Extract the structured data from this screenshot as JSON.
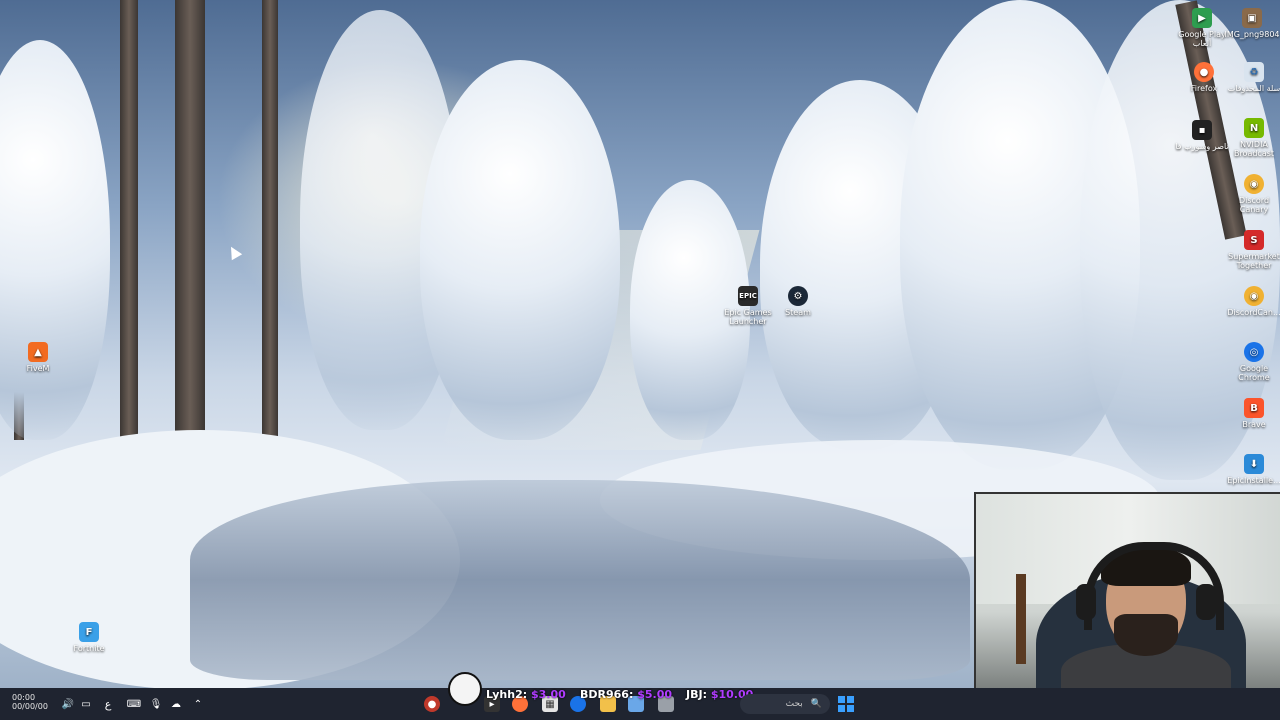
{
  "desktop_icons": {
    "right_column": [
      {
        "label": "Google Play ألعاب",
        "icon": "google-play-games-icon",
        "color": "#2e9d4f"
      },
      {
        "label": "IMG_png9804",
        "icon": "image-file-icon",
        "color": "#8a6a4a"
      },
      {
        "label": "سلة المحذوفات",
        "icon": "recycle-bin-icon",
        "color": "#d9e4ef"
      },
      {
        "label": "Firefox",
        "icon": "firefox-icon",
        "color": "#ff7139"
      },
      {
        "label": "ناصر وسورب فا",
        "icon": "shortcut-icon",
        "color": "#222222"
      },
      {
        "label": "NVIDIA Broadcast",
        "icon": "nvidia-icon",
        "color": "#76b900"
      },
      {
        "label": "Discord Canary",
        "icon": "discord-canary-icon",
        "color": "#f0b132"
      },
      {
        "label": "Supermarket Together",
        "icon": "supermarket-together-icon",
        "color": "#d42a2a"
      },
      {
        "label": "DiscordCan...",
        "icon": "discord-canary-icon",
        "color": "#f0b132"
      },
      {
        "label": "Google Chrome",
        "icon": "chrome-icon",
        "color": "#1a73e8"
      },
      {
        "label": "Brave",
        "icon": "brave-icon",
        "color": "#fb542b"
      },
      {
        "label": "EpicInstalle...",
        "icon": "epic-installer-icon",
        "color": "#2b8ad8"
      }
    ],
    "center": [
      {
        "label": "Epic Games Launcher",
        "icon": "epic-games-icon",
        "color": "#2a2a2a"
      },
      {
        "label": "Steam",
        "icon": "steam-icon",
        "color": "#1b2838"
      }
    ],
    "left": [
      {
        "label": "FiveM",
        "icon": "fivem-icon",
        "color": "#f26b21"
      },
      {
        "label": "Fortnite",
        "icon": "fortnite-icon",
        "color": "#3aa0e8"
      }
    ]
  },
  "taskbar": {
    "clock": {
      "time": "00:00",
      "date": "00/00/00"
    },
    "language": "ع",
    "search_placeholder": "بحث",
    "donations": [
      {
        "name": "Lyhh2:",
        "amount": "$3.00"
      },
      {
        "name": "BDR966:",
        "amount": "$5.00"
      },
      {
        "name": "JBJ:",
        "amount": "$10.00"
      }
    ],
    "apps": [
      "obs-icon",
      "terminal-icon",
      "firefox-icon",
      "store-icon",
      "chrome-icon",
      "folder-icon",
      "photos-icon",
      "app-icon"
    ],
    "start_icon": "windows-start-icon"
  }
}
